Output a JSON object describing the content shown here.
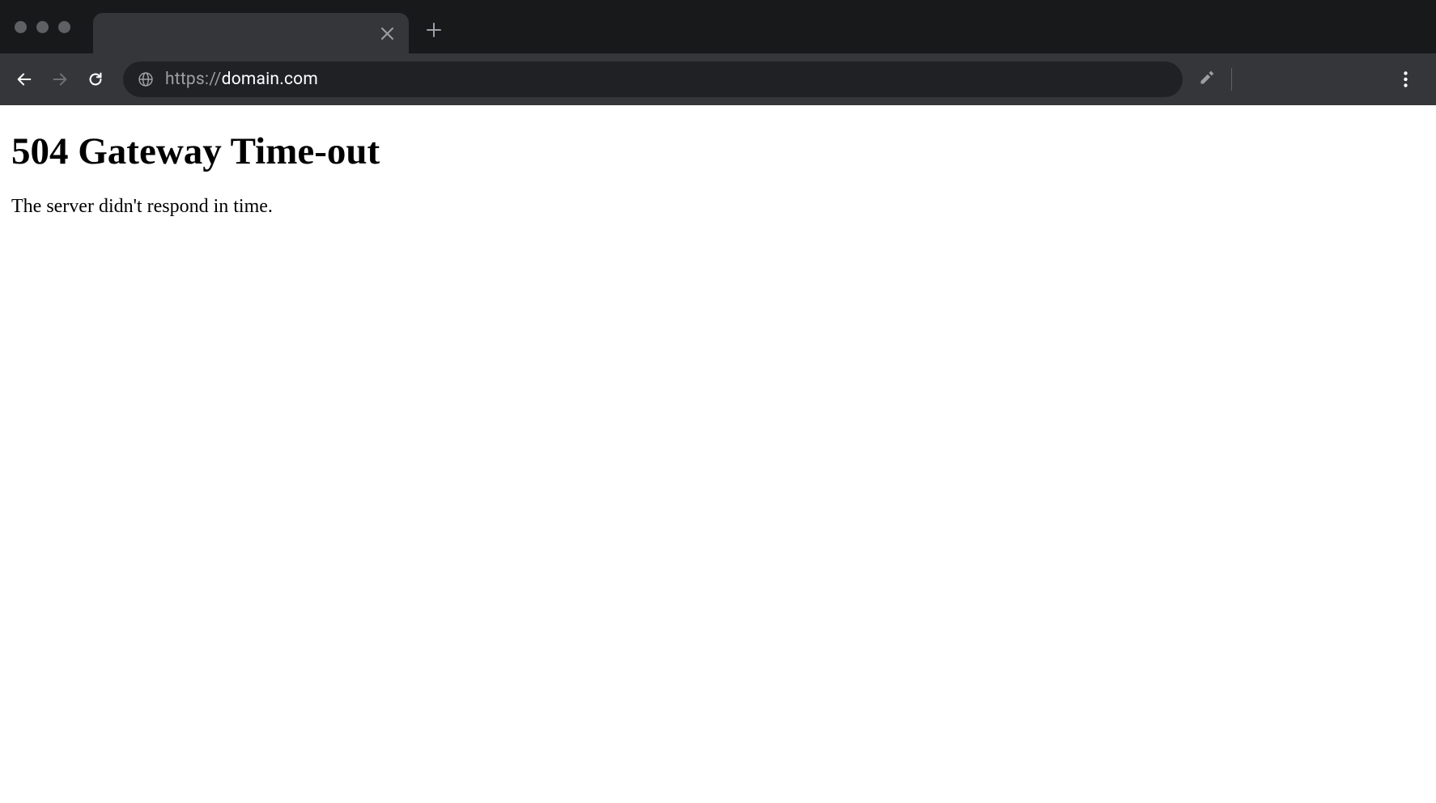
{
  "browser": {
    "url_protocol": "https://",
    "url_domain": "domain.com"
  },
  "page": {
    "heading": "504 Gateway Time-out",
    "message": "The server didn't respond in time."
  }
}
